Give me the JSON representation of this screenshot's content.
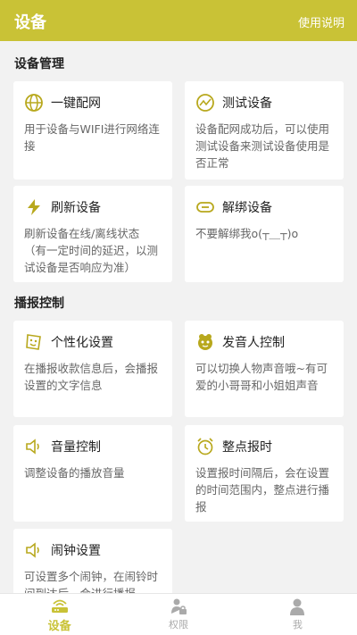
{
  "header": {
    "title": "设备",
    "help": "使用说明"
  },
  "sections": {
    "device_mgmt": "设备管理",
    "broadcast": "播报控制"
  },
  "cards": {
    "one_key": {
      "title": "一键配网",
      "desc": "用于设备与WIFI进行网络连接"
    },
    "test_device": {
      "title": "测试设备",
      "desc": "设备配网成功后，可以使用测试设备来测试设备使用是否正常"
    },
    "refresh": {
      "title": "刷新设备",
      "desc": "刷新设备在线/离线状态（有一定时间的延迟，以测试设备是否响应为准）"
    },
    "unbind": {
      "title": "解绑设备",
      "desc": "不要解绑我o(┬＿┬)o"
    },
    "personal": {
      "title": "个性化设置",
      "desc": "在播报收款信息后，会播报设置的文字信息"
    },
    "speaker": {
      "title": "发音人控制",
      "desc": "可以切换人物声音哦~有可爱的小哥哥和小姐姐声音"
    },
    "volume": {
      "title": "音量控制",
      "desc": "调整设备的播放音量"
    },
    "hourly": {
      "title": "整点报时",
      "desc": "设置报时间隔后，会在设置的时间范围内，整点进行播报"
    },
    "alarm": {
      "title": "闹钟设置",
      "desc": "可设置多个闹钟，在闹铃时间到达后，会进行播报"
    }
  },
  "tabs": [
    {
      "label": "设备"
    },
    {
      "label": "权限"
    },
    {
      "label": "我"
    }
  ],
  "colors": {
    "accent": "#c9c236",
    "icon": "#b8a81d"
  }
}
